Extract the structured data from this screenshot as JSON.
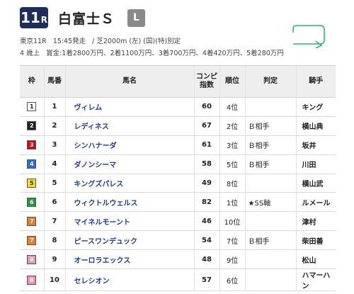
{
  "race": {
    "number": "11",
    "r": "R",
    "name": "白富士Ｓ",
    "grade": "L"
  },
  "info": {
    "venue_race": "東京11R",
    "start": "15:45発走",
    "course": "/ 芝2000m (左) (国)(特)別定",
    "age": "4 歳上",
    "prize": "賞金:1着2800万円、2着1100万円、3着700万円、4着420万円、5着280万円"
  },
  "table": {
    "headers": {
      "waku": "枠",
      "num": "馬番",
      "name": "馬名",
      "index_line1": "コンピ",
      "index_line2": "指数",
      "rank": "順位",
      "judge": "判定",
      "jockey": "騎手"
    },
    "rows": [
      {
        "waku": "1",
        "waku_bg": "#ffffff",
        "waku_fg": "#222222",
        "num": "1",
        "name": "ヴィレム",
        "index": "60",
        "rank": "4位",
        "judge": "",
        "jockey": "キング"
      },
      {
        "waku": "2",
        "waku_bg": "#222222",
        "waku_fg": "#ffffff",
        "num": "2",
        "name": "レディネス",
        "index": "67",
        "rank": "2位",
        "judge": "Ｂ相手",
        "jockey": "横山典"
      },
      {
        "waku": "3",
        "waku_bg": "#e60012",
        "waku_fg": "#ffffff",
        "num": "3",
        "name": "シンハナーダ",
        "index": "61",
        "rank": "3位",
        "judge": "Ｂ相手",
        "jockey": "坂井"
      },
      {
        "waku": "4",
        "waku_bg": "#1e6fd9",
        "waku_fg": "#ffffff",
        "num": "4",
        "name": "ダノンシーマ",
        "index": "58",
        "rank": "5位",
        "judge": "Ｂ相手",
        "jockey": "川田"
      },
      {
        "waku": "5",
        "waku_bg": "#ffe100",
        "waku_fg": "#222222",
        "num": "5",
        "name": "キングズパレス",
        "index": "49",
        "rank": "8位",
        "judge": "",
        "jockey": "横山武"
      },
      {
        "waku": "6",
        "waku_bg": "#1a9a3a",
        "waku_fg": "#ffffff",
        "num": "6",
        "name": "ウィクトルウェルス",
        "index": "82",
        "rank": "1位",
        "judge": "★SS軸",
        "jockey": "ルメール"
      },
      {
        "waku": "7",
        "waku_bg": "#f07c22",
        "waku_fg": "#ffffff",
        "num": "7",
        "name": "マイネルモーント",
        "index": "46",
        "rank": "10位",
        "judge": "",
        "jockey": "津村"
      },
      {
        "waku": "7",
        "waku_bg": "#f07c22",
        "waku_fg": "#ffffff",
        "num": "8",
        "name": "ピースワンデュック",
        "index": "54",
        "rank": "7位",
        "judge": "Ｂ相手",
        "jockey": "柴田善"
      },
      {
        "waku": "8",
        "waku_bg": "#f48fb1",
        "waku_fg": "#ffffff",
        "num": "9",
        "name": "オーロラエックス",
        "index": "48",
        "rank": "9位",
        "judge": "",
        "jockey": "松山"
      },
      {
        "waku": "8",
        "waku_bg": "#f48fb1",
        "waku_fg": "#ffffff",
        "num": "10",
        "name": "セレシオン",
        "index": "57",
        "rank": "6位",
        "judge": "",
        "jockey": "ハマーハン"
      }
    ]
  },
  "colors": {
    "header_badge": "#1f2d5a",
    "grade_badge": "#8a8a8a",
    "horse_name": "#1f3c8f",
    "course_icon": "#2bb673"
  },
  "icons": {
    "course": "course-turn-icon"
  }
}
